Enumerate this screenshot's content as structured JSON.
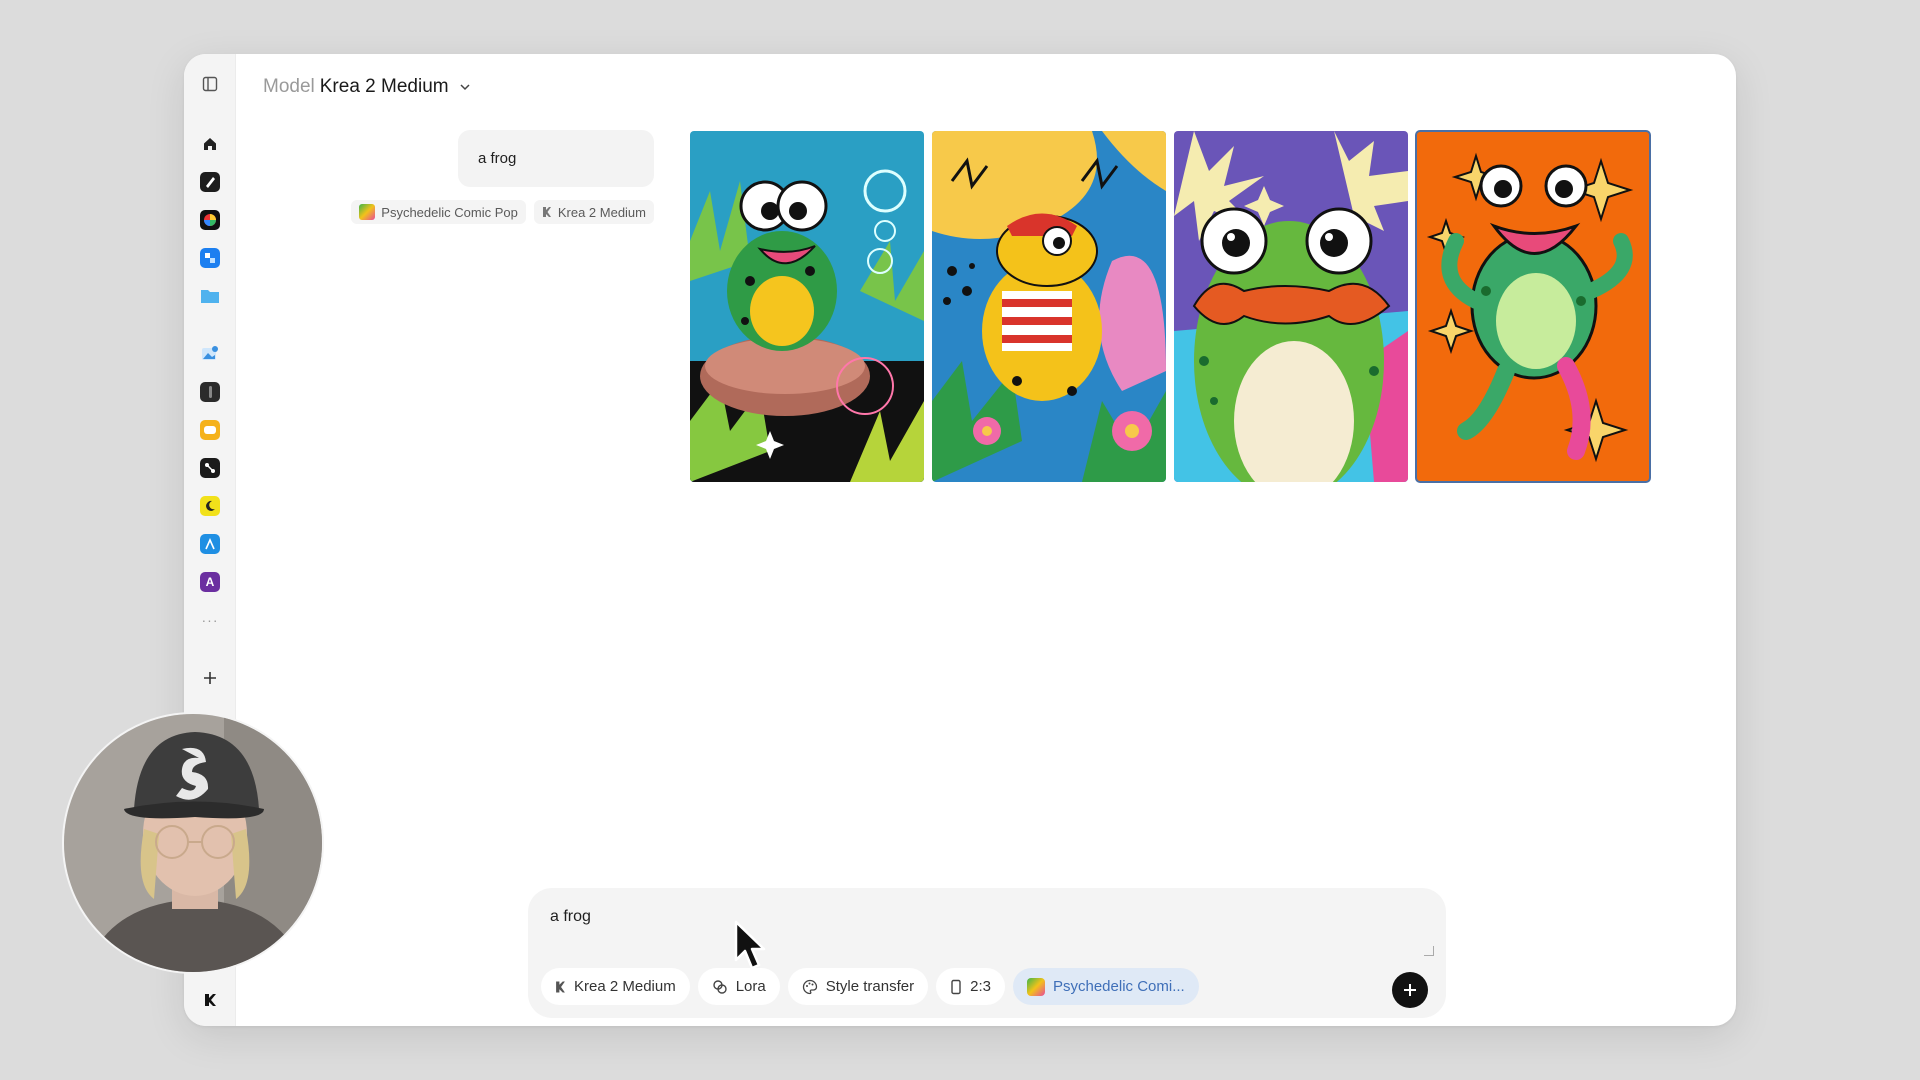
{
  "header": {
    "model_label": "Model",
    "model_value": "Krea 2 Medium"
  },
  "history": {
    "prompt": "a frog",
    "style_tag": "Psychedelic Comic Pop",
    "model_tag": "Krea 2 Medium"
  },
  "gallery": {
    "images": [
      {
        "name": "frog-on-rock-with-bubbles",
        "bg": "#2a9fc4"
      },
      {
        "name": "frog-in-striped-shirt",
        "bg": "#2a86c6"
      },
      {
        "name": "frog-with-mustache",
        "bg": "#6a55b8"
      },
      {
        "name": "dancing-frog-orange",
        "bg": "#f26a0c"
      }
    ],
    "selected_index": 3
  },
  "composer": {
    "prompt_value": "a frog",
    "chips": {
      "model": "Krea 2 Medium",
      "lora": "Lora",
      "style_transfer": "Style transfer",
      "aspect": "2:3",
      "style": "Psychedelic Comi..."
    }
  },
  "sidebar": {
    "icons": [
      "sidebar-toggle-icon",
      "home-icon",
      "pen-icon",
      "color-wheel-icon",
      "cube-icon",
      "folder-icon",
      "image-edit-icon",
      "video-icon",
      "chat-icon",
      "nodes-icon",
      "moon-icon",
      "vector-icon",
      "text-icon",
      "more-icon",
      "plus-icon",
      "krea-logo-icon"
    ]
  },
  "colors": {
    "accent_blue": "#3f6fb8",
    "style_chip_bg": "#dfe9f6",
    "send": "#111111"
  }
}
